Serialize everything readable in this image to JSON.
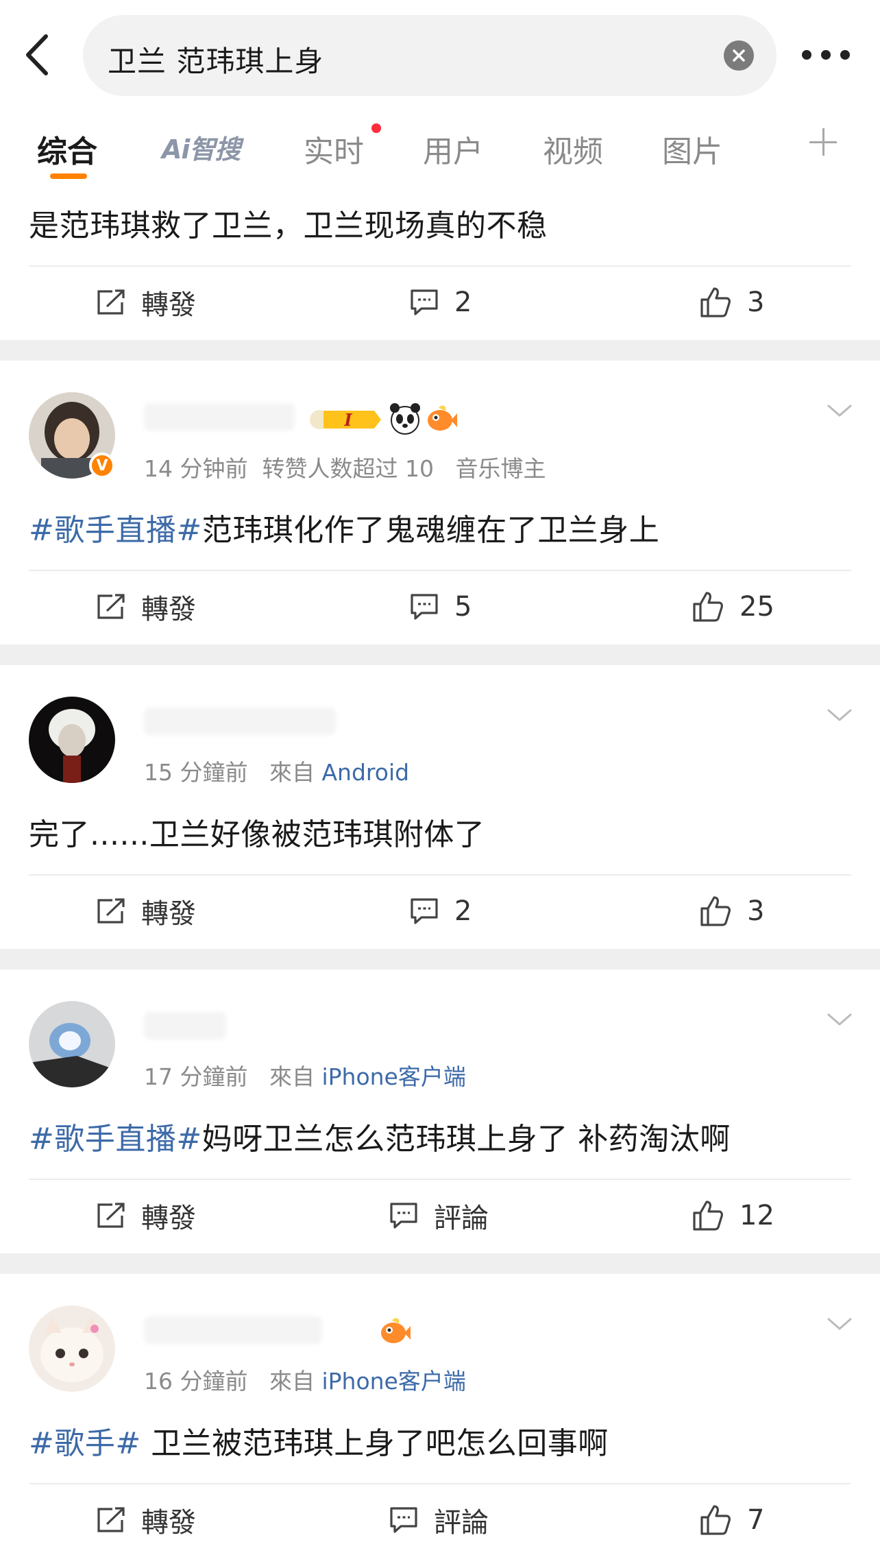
{
  "search": {
    "query": "卫兰 范玮琪上身"
  },
  "tabs": [
    {
      "label": "综合"
    },
    {
      "label": "Ai智搜"
    },
    {
      "label": "实时"
    },
    {
      "label": "用户"
    },
    {
      "label": "视频"
    },
    {
      "label": "图片"
    }
  ],
  "colors": {
    "accent": "#ff8200",
    "hashtag": "#3d6aa8",
    "muted": "#8a8a8a"
  },
  "posts": [
    {
      "text": "是范玮琪救了卫兰，卫兰现场真的不稳",
      "repost_label": "轉發",
      "comment_label": "2",
      "likes": "3"
    },
    {
      "time": "14 分钟前",
      "extra": "转赞人数超过 10",
      "tag": "音乐博主",
      "level": "I",
      "hashtag": "#歌手直播#",
      "text": "范玮琪化作了鬼魂缠在了卫兰身上",
      "repost_label": "轉發",
      "comment_label": "5",
      "likes": "25"
    },
    {
      "time": "15 分鐘前",
      "from_label": "來自",
      "source": "Android",
      "text": "完了......卫兰好像被范玮琪附体了",
      "repost_label": "轉發",
      "comment_label": "2",
      "likes": "3"
    },
    {
      "time": "17 分鐘前",
      "from_label": "來自",
      "source": "iPhone客户端",
      "hashtag": "#歌手直播#",
      "text": "妈呀卫兰怎么范玮琪上身了 补药淘汰啊",
      "repost_label": "轉發",
      "comment_label": "評論",
      "likes": "12"
    },
    {
      "time": "16 分鐘前",
      "from_label": "來自",
      "source": "iPhone客户端",
      "hashtag": "#歌手#",
      "text": " 卫兰被范玮琪上身了吧怎么回事啊",
      "repost_label": "轉發",
      "comment_label": "評論",
      "likes": "7"
    }
  ]
}
